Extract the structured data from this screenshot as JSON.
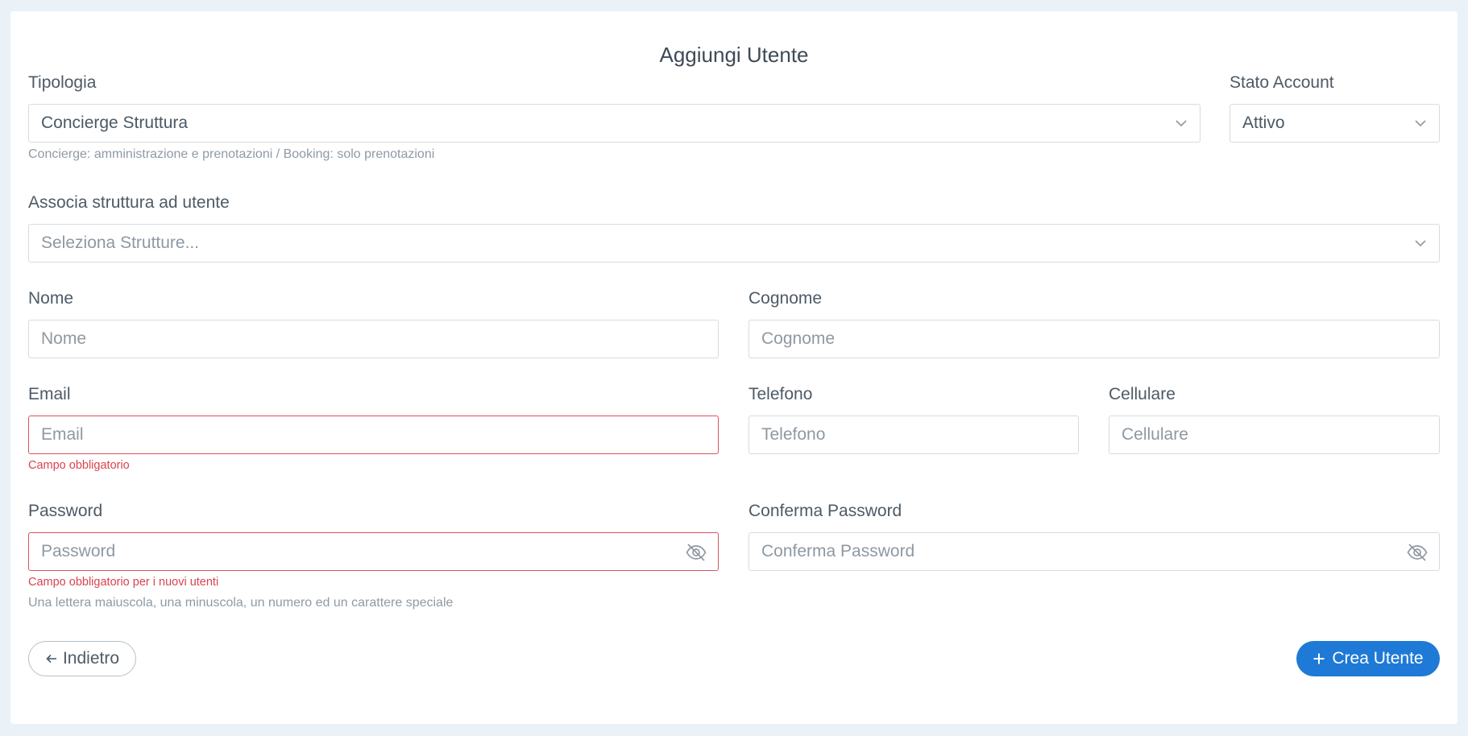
{
  "page": {
    "title": "Aggiungi Utente"
  },
  "form": {
    "tipologia": {
      "label": "Tipologia",
      "value": "Concierge Struttura",
      "help": "Concierge: amministrazione e prenotazioni / Booking: solo prenotazioni"
    },
    "stato_account": {
      "label": "Stato Account",
      "value": "Attivo"
    },
    "strutture": {
      "label": "Associa struttura ad utente",
      "placeholder": "Seleziona Strutture..."
    },
    "nome": {
      "label": "Nome",
      "placeholder": "Nome",
      "value": ""
    },
    "cognome": {
      "label": "Cognome",
      "placeholder": "Cognome",
      "value": ""
    },
    "email": {
      "label": "Email",
      "placeholder": "Email",
      "value": "",
      "error": "Campo obbligatorio"
    },
    "telefono": {
      "label": "Telefono",
      "placeholder": "Telefono",
      "value": ""
    },
    "cellulare": {
      "label": "Cellulare",
      "placeholder": "Cellulare",
      "value": ""
    },
    "password": {
      "label": "Password",
      "placeholder": "Password",
      "value": "",
      "error": "Campo obbligatorio per i nuovi utenti",
      "help": "Una lettera maiuscola, una minuscola, un numero ed un carattere speciale"
    },
    "conferma_password": {
      "label": "Conferma Password",
      "placeholder": "Conferma Password",
      "value": ""
    }
  },
  "actions": {
    "back_label": "Indietro",
    "create_label": "Crea Utente"
  },
  "icons": {
    "chevron": "chevron-down-icon",
    "eye": "eye-off-icon",
    "back": "arrow-left-icon",
    "plus": "plus-icon"
  },
  "colors": {
    "primary": "#1e7ad6",
    "error": "#d9434f",
    "background": "#eaf2f7"
  }
}
